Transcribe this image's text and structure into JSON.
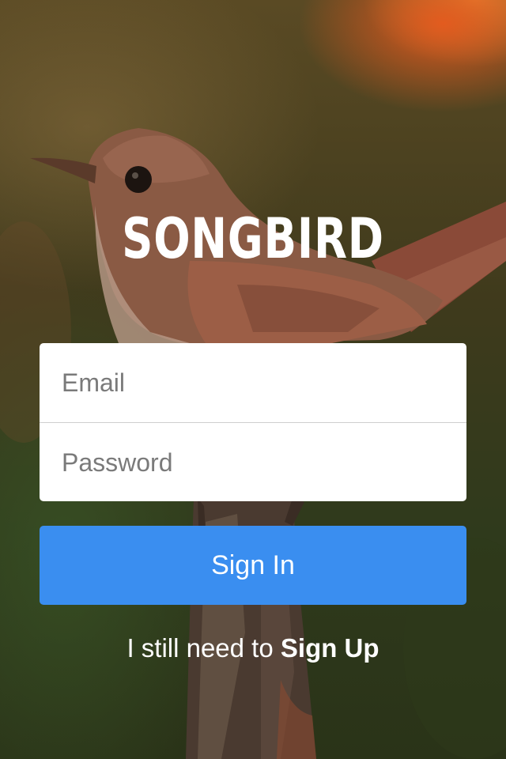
{
  "app": {
    "logo_text": "SONGBIRD",
    "background_image": "songbird-photo"
  },
  "login_form": {
    "email_placeholder": "Email",
    "email_value": "",
    "password_placeholder": "Password",
    "password_value": ""
  },
  "actions": {
    "sign_in_label": "Sign In",
    "signup_prompt": "I still need to ",
    "signup_link": "Sign Up"
  },
  "colors": {
    "primary_button": "#3a8ef0",
    "card_background": "#ffffff",
    "text_light": "#ffffff"
  }
}
